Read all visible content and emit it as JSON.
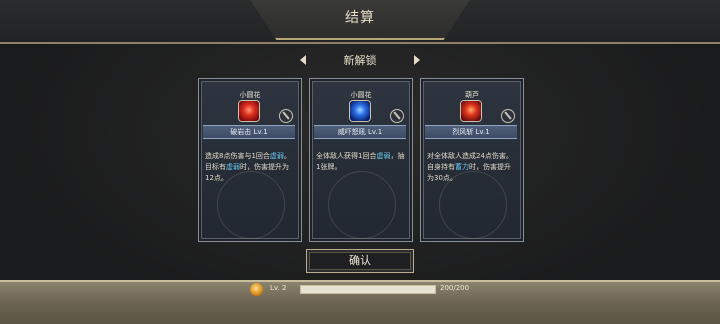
{
  "header": {
    "title": "结算"
  },
  "section": {
    "title": "新解锁"
  },
  "cards": [
    {
      "name": "小圆花",
      "skill": "破岩击 Lv.1",
      "desc_parts": [
        {
          "t": "造成8点伤害与1回合"
        },
        {
          "t": "虚弱",
          "hl": true
        },
        {
          "t": "。"
        },
        {
          "t": "\n目标有"
        },
        {
          "t": "虚弱",
          "hl": true
        },
        {
          "t": "时，伤害提升为12点。"
        }
      ],
      "icon": "red-skill-icon"
    },
    {
      "name": "小圆花",
      "skill": "威吓怒吼 Lv.1",
      "desc_parts": [
        {
          "t": "全体敌人获得1回合"
        },
        {
          "t": "虚弱",
          "hl": true
        },
        {
          "t": "，抽1张牌。"
        }
      ],
      "icon": "blue-skill-icon"
    },
    {
      "name": "葫芦",
      "skill": "烈风斩 Lv.1",
      "desc_parts": [
        {
          "t": "对全体敌人造成24点伤害。"
        },
        {
          "t": "\n自身持有"
        },
        {
          "t": "蓄力",
          "hl": true
        },
        {
          "t": "时，伤害提升为30点。"
        }
      ],
      "icon": "orange-skill-icon"
    }
  ],
  "confirm_button": {
    "label": "确认"
  },
  "player": {
    "level": "Lv. 2",
    "xp_text": "200/200",
    "xp_fraction": 1.0
  },
  "colors": {
    "highlight": "#64c6f0",
    "accent": "#b8a777"
  }
}
